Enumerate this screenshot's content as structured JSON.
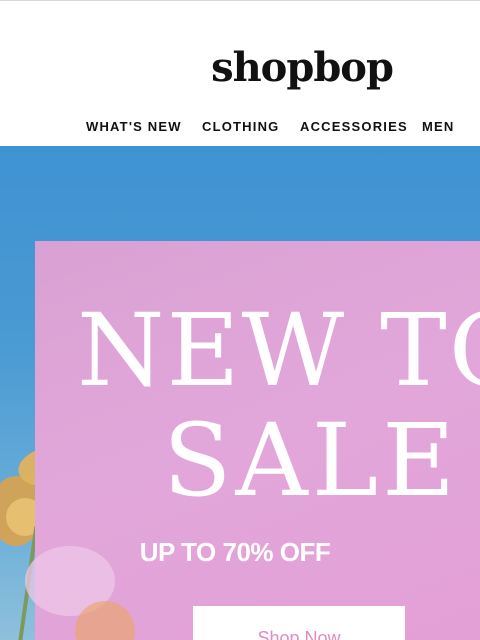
{
  "brand": {
    "logo_text": "shopbop"
  },
  "nav": {
    "items": [
      {
        "label": "WHAT'S NEW"
      },
      {
        "label": "CLOTHING"
      },
      {
        "label": "ACCESSORIES"
      },
      {
        "label": "MEN"
      }
    ]
  },
  "hero": {
    "headline_line1": "NEW TO",
    "headline_line2": "SALE",
    "subheadline": "UP TO 70% OFF",
    "cta_label": "Shop Now"
  },
  "colors": {
    "sky": "#4a9ad3",
    "card_pink": "#e2a7da",
    "cta_text": "#e08cc2",
    "text_dark": "#111111"
  }
}
